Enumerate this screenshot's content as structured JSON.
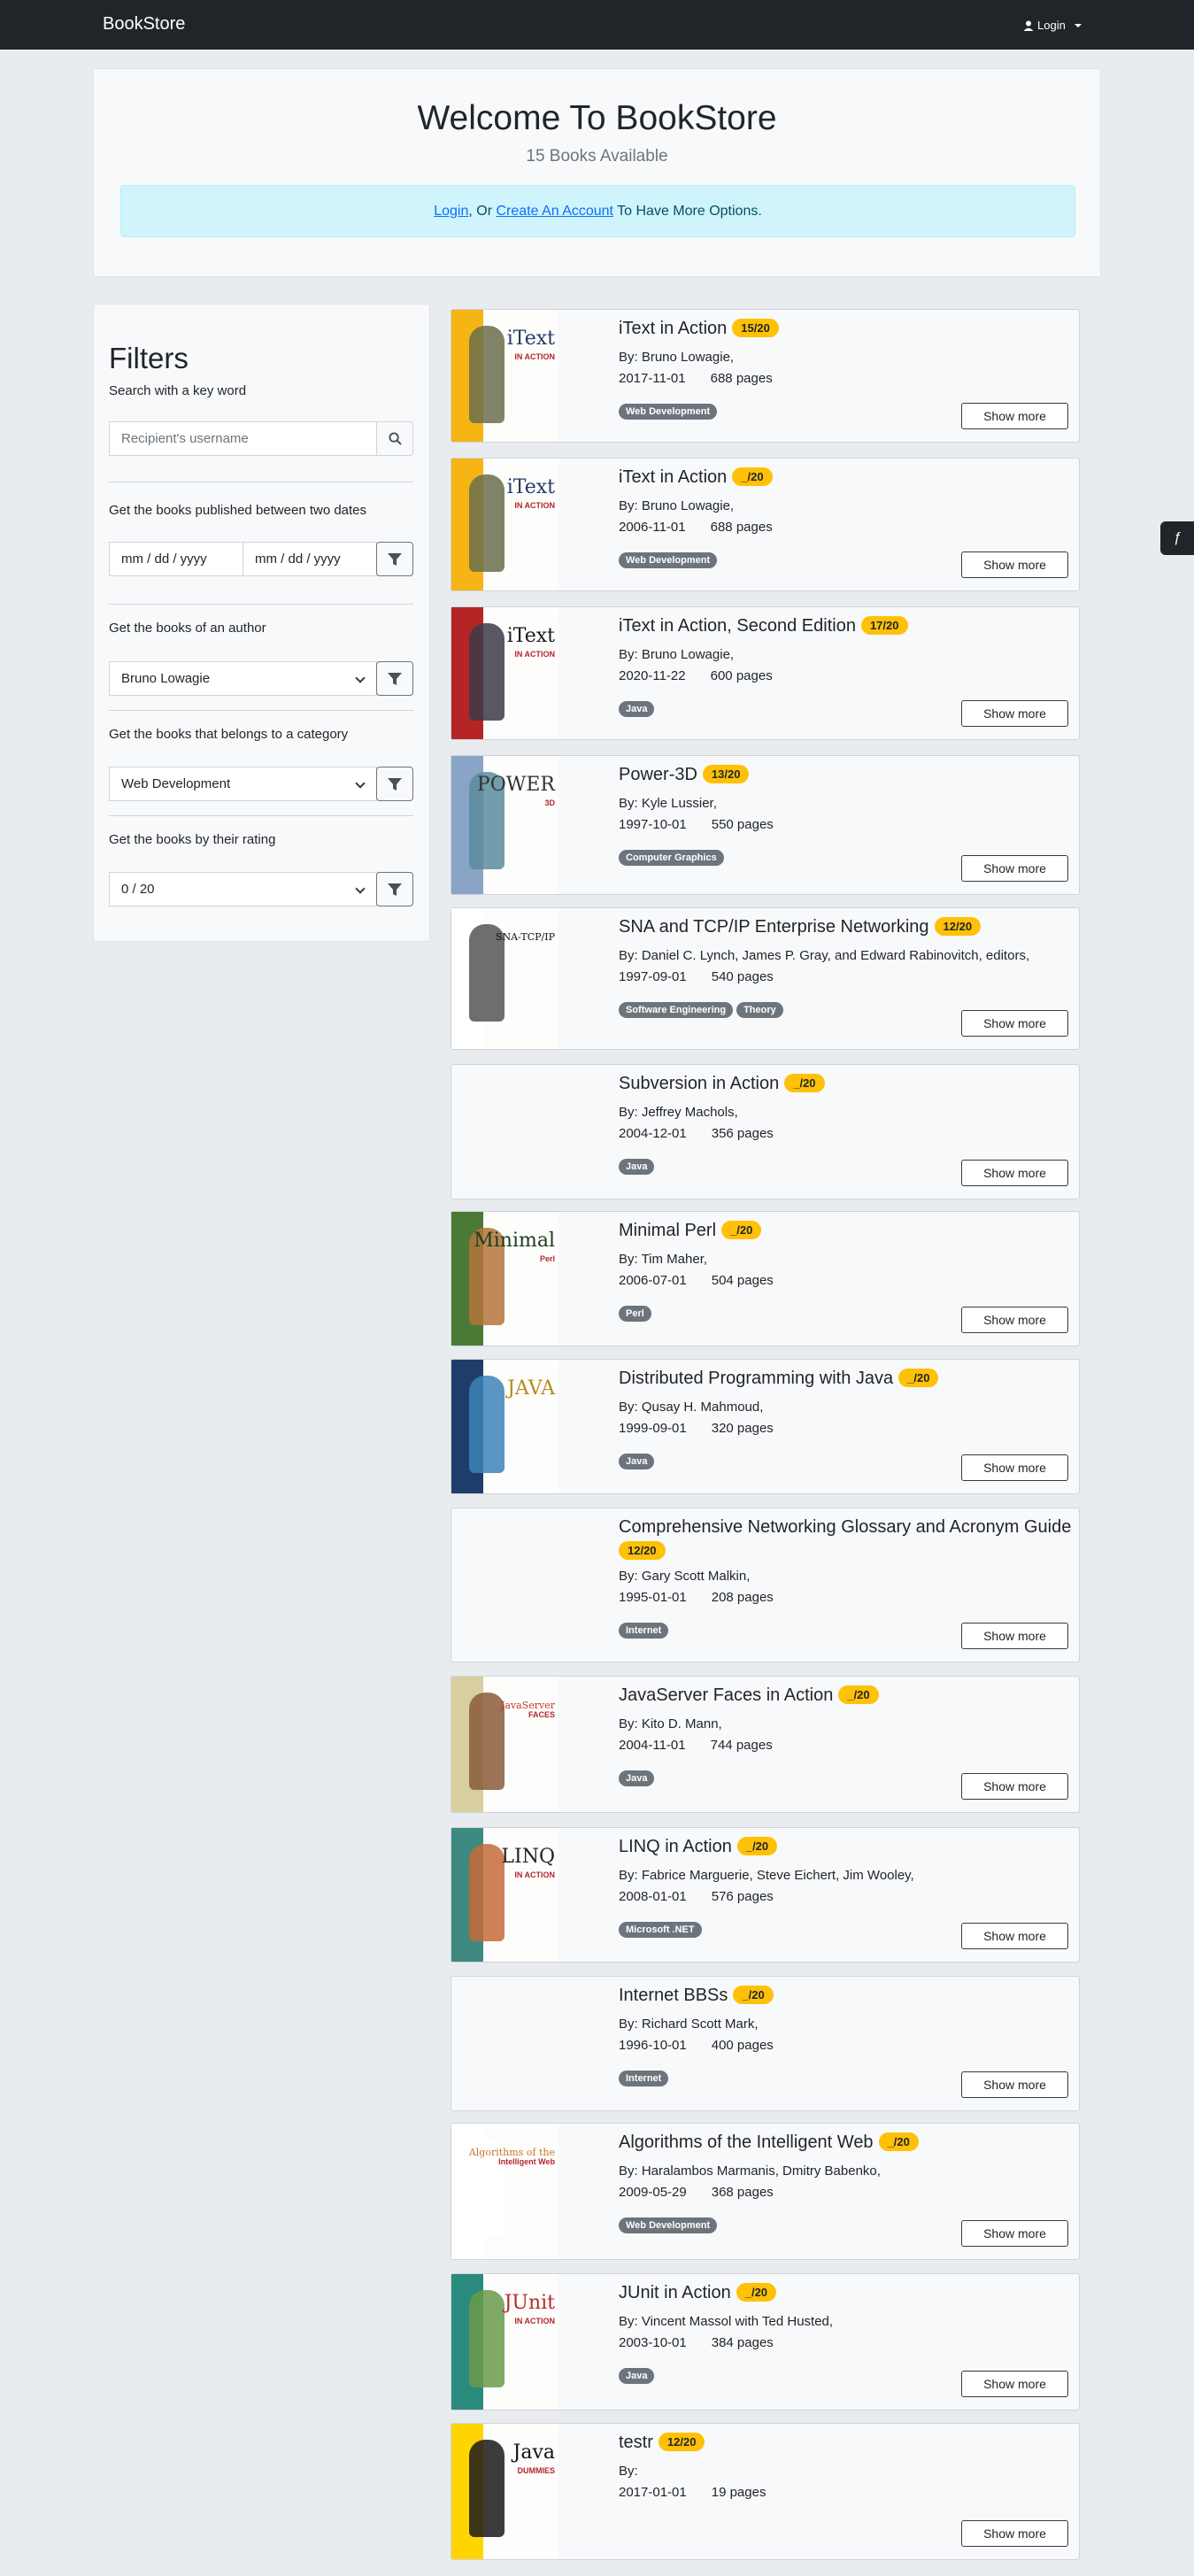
{
  "navbar": {
    "brand": "BookStore",
    "login": "Login"
  },
  "welcome": {
    "title": "Welcome To BookStore",
    "subtitle": "15 Books Available",
    "alert": {
      "login_link": "Login",
      "middle": ", Or ",
      "create_link": "Create An Account",
      "suffix": " To Have More Options."
    }
  },
  "filters": {
    "title": "Filters",
    "keyword_label": "Search with a key word",
    "keyword_placeholder": "Recipient's username",
    "dates_label": "Get the books published between two dates",
    "date_placeholder": "mm / dd / yyyy",
    "author_label": "Get the books of an author",
    "author_value": "Bruno Lowagie",
    "category_label": "Get the books that belongs to a category",
    "category_value": "Web Development",
    "rating_label": "Get the books by their rating",
    "rating_value": "0 / 20"
  },
  "books": [
    {
      "title": "iText in Action",
      "rating": "15/20",
      "authors": "By: Bruno Lowagie,",
      "date": "2017-11-01",
      "pages": "688 pages",
      "tags": [
        "Web Development"
      ],
      "cover": "itext"
    },
    {
      "title": "iText in Action",
      "rating": "_/20",
      "authors": "By: Bruno Lowagie,",
      "date": "2006-11-01",
      "pages": "688 pages",
      "tags": [
        "Web Development"
      ],
      "cover": "itext"
    },
    {
      "title": "iText in Action, Second Edition",
      "rating": "17/20",
      "authors": "By: Bruno Lowagie,",
      "date": "2020-11-22",
      "pages": "600 pages",
      "tags": [
        "Java"
      ],
      "cover": "itext2"
    },
    {
      "title": "Power-3D",
      "rating": "13/20",
      "authors": "By: Kyle Lussier,",
      "date": "1997-10-01",
      "pages": "550 pages",
      "tags": [
        "Computer Graphics"
      ],
      "cover": "power3d"
    },
    {
      "title": "SNA and TCP/IP Enterprise Networking",
      "rating": "12/20",
      "authors": "By: Daniel C. Lynch, James P. Gray, and Edward Rabinovitch, editors,",
      "date": "1997-09-01",
      "pages": "540 pages",
      "tags": [
        "Software Engineering",
        "Theory"
      ],
      "cover": "sna"
    },
    {
      "title": "Subversion in Action",
      "rating": "_/20",
      "authors": "By: Jeffrey Machols,",
      "date": "2004-12-01",
      "pages": "356 pages",
      "tags": [
        "Java"
      ],
      "cover": "none"
    },
    {
      "title": "Minimal Perl",
      "rating": "_/20",
      "authors": "By: Tim Maher,",
      "date": "2006-07-01",
      "pages": "504 pages",
      "tags": [
        "Perl"
      ],
      "cover": "perl"
    },
    {
      "title": "Distributed Programming with Java",
      "rating": "_/20",
      "authors": "By: Qusay H. Mahmoud,",
      "date": "1999-09-01",
      "pages": "320 pages",
      "tags": [
        "Java"
      ],
      "cover": "distjava"
    },
    {
      "title": "Comprehensive Networking Glossary and Acronym Guide",
      "rating": "12/20",
      "authors": "By: Gary Scott Malkin,",
      "date": "1995-01-01",
      "pages": "208 pages",
      "tags": [
        "Internet"
      ],
      "cover": "none"
    },
    {
      "title": "JavaServer Faces in Action",
      "rating": "_/20",
      "authors": "By: Kito D. Mann,",
      "date": "2004-11-01",
      "pages": "744 pages",
      "tags": [
        "Java"
      ],
      "cover": "jsf"
    },
    {
      "title": "LINQ in Action",
      "rating": "_/20",
      "authors": "By: Fabrice Marguerie, Steve Eichert, Jim Wooley,",
      "date": "2008-01-01",
      "pages": "576 pages",
      "tags": [
        "Microsoft .NET"
      ],
      "cover": "linq"
    },
    {
      "title": "Internet BBSs",
      "rating": "_/20",
      "authors": "By: Richard Scott Mark,",
      "date": "1996-10-01",
      "pages": "400 pages",
      "tags": [
        "Internet"
      ],
      "cover": "none"
    },
    {
      "title": "Algorithms of the Intelligent Web",
      "rating": "_/20",
      "authors": "By: Haralambos Marmanis, Dmitry Babenko,",
      "date": "2009-05-29",
      "pages": "368 pages",
      "tags": [
        "Web Development"
      ],
      "cover": "algo"
    },
    {
      "title": "JUnit in Action",
      "rating": "_/20",
      "authors": "By: Vincent Massol with Ted Husted,",
      "date": "2003-10-01",
      "pages": "384 pages",
      "tags": [
        "Java"
      ],
      "cover": "junit"
    },
    {
      "title": "testr",
      "rating": "12/20",
      "authors": "By:",
      "date": "2017-01-01",
      "pages": "19 pages",
      "tags": [],
      "cover": "dummies"
    }
  ],
  "show_more": "Show more",
  "covers": {
    "itext": {
      "spine": "#f4b515",
      "text": "iText",
      "sub": "IN ACTION",
      "figure": "#6a6f4c",
      "color": "#233a6b"
    },
    "itext2": {
      "spine": "#b52525",
      "text": "iText",
      "sub": "IN ACTION",
      "figure": "#3d3a4a",
      "color": "#1a1a1a"
    },
    "power3d": {
      "spine": "#8aa4c8",
      "text": "POWER",
      "sub": "3D",
      "figure": "#5a8c9c",
      "color": "#333"
    },
    "sna": {
      "spine": "#ffffff",
      "text": "SNA-TCP/IP",
      "sub": "",
      "figure": "#555",
      "color": "#111"
    },
    "perl": {
      "spine": "#4a7a36",
      "text": "Minimal",
      "sub": "Perl",
      "figure": "#b3743a",
      "color": "#1d3d1d"
    },
    "distjava": {
      "spine": "#1f3d6b",
      "text": "JAVA",
      "sub": "",
      "figure": "#3d82b8",
      "color": "#b38b1d"
    },
    "jsf": {
      "spine": "#d8cfa1",
      "text": "JavaServer",
      "sub": "FACES",
      "figure": "#8a5a3a",
      "color": "#c43a2a"
    },
    "linq": {
      "spine": "#3e8a80",
      "text": "LINQ",
      "sub": "IN ACTION",
      "figure": "#c66a3a",
      "color": "#222"
    },
    "algo": {
      "spine": "#ffffff",
      "text": "Algorithms of the",
      "sub": "Intelligent Web",
      "figure": "#fff",
      "color": "#c8762a"
    },
    "junit": {
      "spine": "#2b8a7e",
      "text": "JUnit",
      "sub": "IN ACTION",
      "figure": "#6a9a4a",
      "color": "#b82a2a"
    },
    "dummies": {
      "spine": "#ffd400",
      "text": "Java",
      "sub": "DUMMIES",
      "figure": "#1a1a1a",
      "color": "#111"
    }
  }
}
